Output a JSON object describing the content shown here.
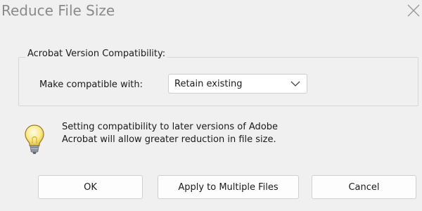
{
  "dialog": {
    "title": "Reduce File Size"
  },
  "compatibility_group": {
    "legend": "Acrobat Version Compatibility:",
    "make_compatible_label": "Make compatible with:",
    "selected_value": "Retain existing"
  },
  "info": {
    "line1": "Setting compatibility to later versions of Adobe",
    "line2": "Acrobat will allow greater reduction in file size."
  },
  "buttons": {
    "ok": "OK",
    "apply_multiple": "Apply to Multiple Files",
    "cancel": "Cancel"
  },
  "icons": {
    "close": "close-icon",
    "dropdown": "chevron-down-icon",
    "info": "lightbulb-icon"
  }
}
